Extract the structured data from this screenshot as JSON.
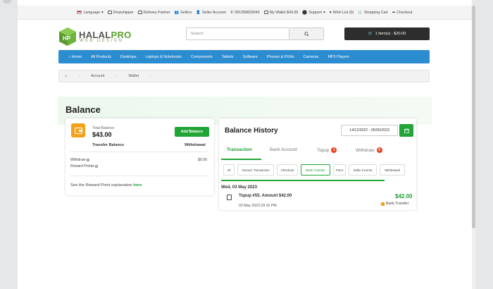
{
  "topbar": {
    "language": "Language",
    "dropshipper": "Dropshipper",
    "delivery_partner": "Delivery Partner",
    "sellers": "Sellers",
    "seller_account": "Seller Account",
    "phone": "081358833040",
    "my_wallet": "My Wallet $43.00",
    "support": "Support",
    "wish_list": "Wish List (0)",
    "shopping_cart": "Shopping Cart",
    "checkout": "Checkout"
  },
  "logo": {
    "name_a": "HALAL",
    "name_b": "PRO",
    "sub": "WEB DESIGN"
  },
  "search": {
    "placeholder": "Search"
  },
  "cart": {
    "label": "1 item(s) - $20.00"
  },
  "nav": {
    "items": [
      "Home",
      "All Products",
      "Desktops",
      "Laptops & Notebooks",
      "Components",
      "Tablets",
      "Software",
      "Phones & PDAs",
      "Cameras",
      "MP3 Players"
    ]
  },
  "breadcrumb": {
    "account": "Account",
    "wallet": "Wallet"
  },
  "page": {
    "title": "Balance"
  },
  "balance": {
    "total_label": "Total Balance",
    "total_amount": "$43.00",
    "add_button": "Add Balance",
    "transfer_balance": "Transfer Balance",
    "withdrawal": "Withdrawal",
    "withdraw_label": "Withdraw",
    "withdraw_value": "$0.00",
    "reward_points_label": "Reward Points",
    "explain_text": "See the Reward Point explanation",
    "explain_link": "here"
  },
  "history": {
    "title": "Balance History",
    "date_range": "14/12/2022 - 05/05/2023",
    "tabs": [
      {
        "label": "Transaction",
        "badge": ""
      },
      {
        "label": "Bank Account",
        "badge": ""
      },
      {
        "label": "Topup",
        "badge": "1"
      },
      {
        "label": "Withdraw",
        "badge": "0"
      }
    ],
    "filters": [
      "All",
      "Generic Transaction",
      "Checkout",
      "Bank Transfer",
      "Point",
      "Seller Income",
      "Withdrawal"
    ],
    "active_filter": "Bank Transfer",
    "date_header": "Wed, 03 May 2023",
    "transaction": {
      "description": "Topup #55. Amount $42.00",
      "time": "03 May 2023 09:16 PM",
      "amount": "$42.00",
      "method": "Bank Transfer"
    }
  },
  "colors": {
    "accent_green": "#21a537",
    "nav_blue": "#2c8cd0",
    "wallet_orange": "#f4a11c",
    "badge_red": "#e8401c"
  }
}
